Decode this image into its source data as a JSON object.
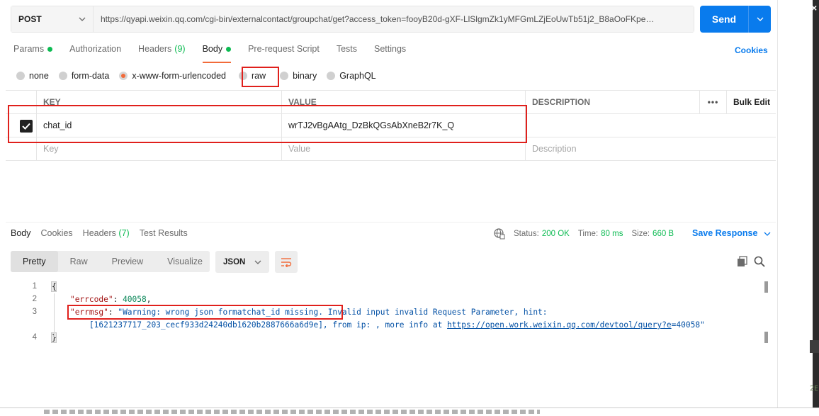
{
  "request": {
    "method": "POST",
    "url": "https://qyapi.weixin.qq.com/cgi-bin/externalcontact/groupchat/get?access_token=fooyB20d-gXF-LlSlgmZk1yMFGmLZjEoUwTb51j2_B8aOoFKpe…",
    "send_label": "Send"
  },
  "req_tabs": [
    {
      "label": "Params",
      "dot": true
    },
    {
      "label": "Authorization"
    },
    {
      "label": "Headers",
      "count": "(9)"
    },
    {
      "label": "Body",
      "dot": true,
      "active": true
    },
    {
      "label": "Pre-request Script"
    },
    {
      "label": "Tests"
    },
    {
      "label": "Settings"
    }
  ],
  "cookies_label": "Cookies",
  "body_types": [
    {
      "label": "none"
    },
    {
      "label": "form-data"
    },
    {
      "label": "x-www-form-urlencoded",
      "selected": true
    },
    {
      "label": "raw"
    },
    {
      "label": "binary"
    },
    {
      "label": "GraphQL"
    }
  ],
  "params_table": {
    "headers": {
      "key": "KEY",
      "value": "VALUE",
      "description": "DESCRIPTION",
      "more": "•••",
      "bulk_edit": "Bulk Edit"
    },
    "rows": [
      {
        "checked": true,
        "key": "chat_id",
        "value": "wrTJ2vBgAAtg_DzBkQGsAbXneB2r7K_Q",
        "description": ""
      }
    ],
    "placeholder": {
      "key": "Key",
      "value": "Value",
      "description": "Description"
    }
  },
  "response": {
    "tabs": [
      {
        "label": "Body",
        "active": true
      },
      {
        "label": "Cookies"
      },
      {
        "label": "Headers",
        "count": "(7)"
      },
      {
        "label": "Test Results"
      }
    ],
    "status_label": "Status:",
    "status_value": "200 OK",
    "time_label": "Time:",
    "time_value": "80 ms",
    "size_label": "Size:",
    "size_value": "660 B",
    "save_label": "Save Response",
    "views": [
      "Pretty",
      "Raw",
      "Preview",
      "Visualize"
    ],
    "format": "JSON",
    "code": {
      "line_numbers": [
        "1",
        "2",
        "3",
        "",
        "4"
      ],
      "open_brace": "{",
      "close_brace": "}",
      "errcode_key": "\"errcode\"",
      "errcode_value": "40058",
      "errmsg_key": "\"errmsg\"",
      "errmsg_value_a": "\"Warning: wrong json formatchat_id missing.",
      "errmsg_value_b": " Invalid input invalid Request Parameter, hint:",
      "errmsg_value_c": "[1621237717_203_cecf933d24240db1620b2887666a6d9e], from ip: , more info at ",
      "errmsg_link": "https://open.work.weixin.qq.com/devtool/query?e",
      "errmsg_tail": "=40058\""
    }
  },
  "side_text": "2E"
}
